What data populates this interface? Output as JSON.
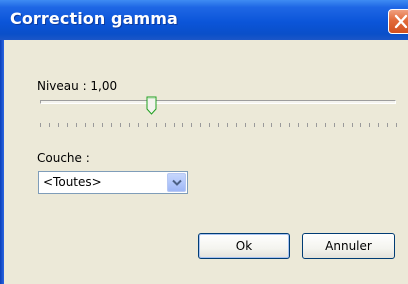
{
  "window": {
    "title": "Correction gamma",
    "close_icon": "close-icon"
  },
  "level": {
    "label": "Niveau : 1,00",
    "value": 1.0,
    "slider_position_fraction": 0.31
  },
  "layer": {
    "label": "Couche :",
    "selected": "<Toutes>"
  },
  "buttons": {
    "ok": "Ok",
    "cancel": "Annuler"
  },
  "colors": {
    "titlebar": "#0b55d9",
    "dialog_bg": "#ece9d8",
    "close_button": "#e26a3a",
    "button_border": "#003c74"
  }
}
